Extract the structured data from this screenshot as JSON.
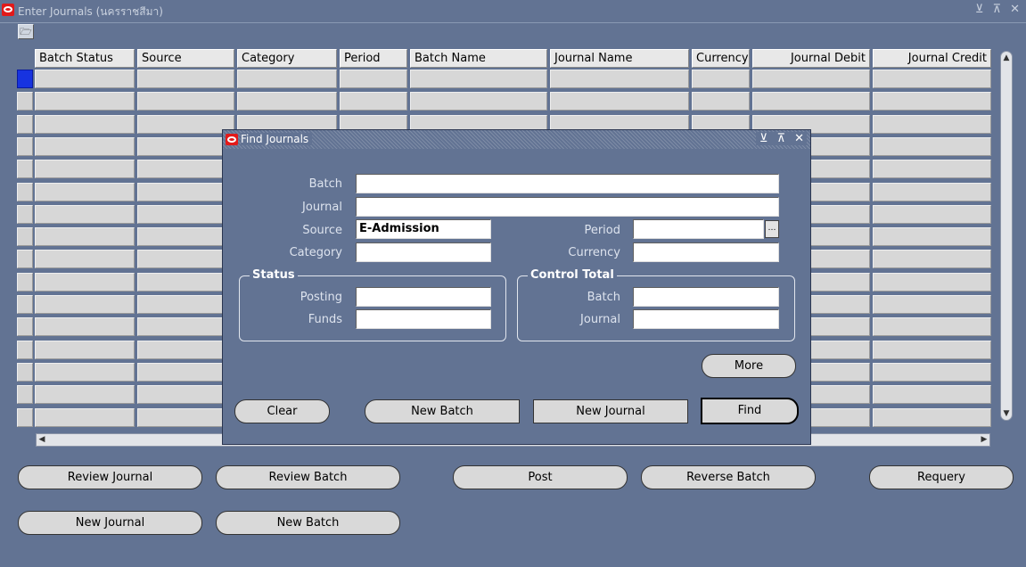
{
  "window": {
    "title": "Enter Journals (นครราชสีมา)",
    "controls": "⊻ ⊼ ✕"
  },
  "grid": {
    "columns": [
      "Batch Status",
      "Source",
      "Category",
      "Period",
      "Batch Name",
      "Journal Name",
      "Currency",
      "Journal Debit",
      "Journal Credit"
    ],
    "row_count": 16
  },
  "buttons": {
    "review_journal": "Review Journal",
    "review_batch": "Review Batch",
    "post": "Post",
    "reverse_batch": "Reverse Batch",
    "requery": "Requery",
    "new_journal": "New Journal",
    "new_batch": "New Batch"
  },
  "find_dialog": {
    "title": "Find Journals",
    "controls": "⊻ ⊼ ✕",
    "labels": {
      "batch": "Batch",
      "journal": "Journal",
      "source": "Source",
      "category": "Category",
      "period": "Period",
      "currency": "Currency",
      "status": "Status",
      "posting": "Posting",
      "funds": "Funds",
      "control_total": "Control Total",
      "ct_batch": "Batch",
      "ct_journal": "Journal"
    },
    "values": {
      "batch": "",
      "journal": "",
      "source": "E-Admission",
      "category": "",
      "period": "",
      "currency": "",
      "posting": "",
      "funds": "",
      "ct_batch": "",
      "ct_journal": ""
    },
    "buttons": {
      "more": "More",
      "clear": "Clear",
      "new_batch": "New Batch",
      "new_journal": "New Journal",
      "find": "Find"
    }
  }
}
